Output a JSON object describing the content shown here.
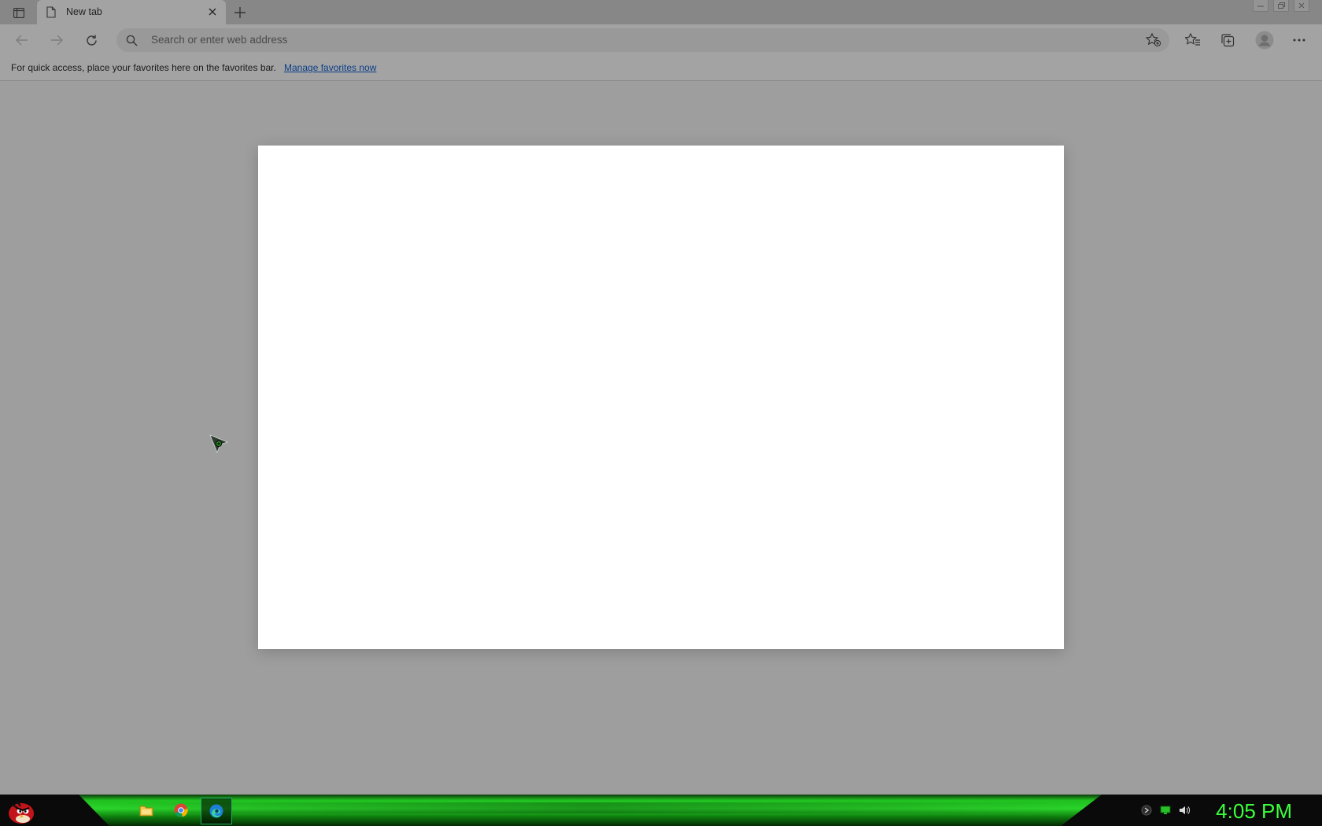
{
  "browser": {
    "tab": {
      "title": "New tab"
    },
    "address_placeholder": "Search or enter web address",
    "favorites_bar": {
      "message": "For quick access, place your favorites here on the favorites bar.",
      "link": "Manage favorites now"
    },
    "icons": {
      "tab_actions": "tab-actions-icon",
      "page": "page-icon",
      "close": "close-icon",
      "new_tab": "plus-icon",
      "back": "back-arrow-icon",
      "forward": "forward-arrow-icon",
      "refresh": "refresh-icon",
      "search": "search-icon",
      "add_favorite": "star-plus-icon",
      "favorites": "favorites-icon",
      "collections": "collections-icon",
      "profile": "profile-icon",
      "more": "more-icon"
    }
  },
  "taskbar": {
    "clock": "4:05 PM",
    "apps": [
      "file-explorer",
      "chrome",
      "edge"
    ],
    "colors": {
      "accent": "#2bd72b",
      "clock": "#3cff3c"
    }
  }
}
